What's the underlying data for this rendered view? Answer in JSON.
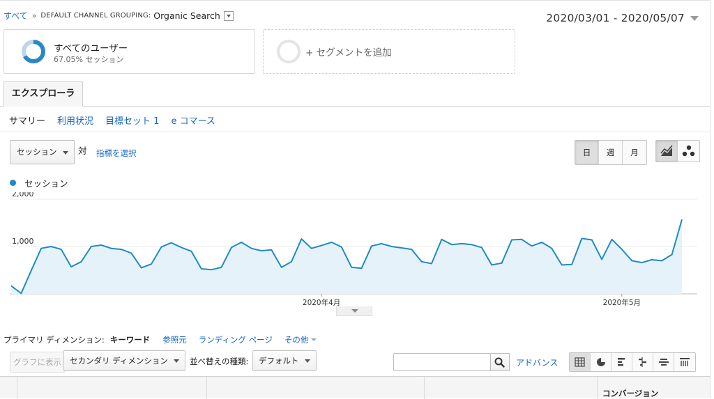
{
  "breadcrumb": {
    "root": "すべて",
    "separator": "»",
    "dimension": "DEFAULT CHANNEL GROUPING:",
    "value": "Organic Search"
  },
  "date_range": "2020/03/01 - 2020/05/07",
  "segments": {
    "all_users": {
      "title": "すべてのユーザー",
      "subtitle": "67.05% セッション",
      "share": 0.6705
    },
    "add_segment": {
      "label": "+ セグメントを追加"
    }
  },
  "explorer_tab": "エクスプローラ",
  "subtabs": [
    "サマリー",
    "利用状況",
    "目標セット 1",
    "e コマース"
  ],
  "metric": {
    "selected": "セッション",
    "vs": "対",
    "choose": "指標を選択"
  },
  "period_buttons": [
    "日",
    "週",
    "月"
  ],
  "chart_type_icons": [
    "line-chart-icon",
    "motion-chart-icon"
  ],
  "legend": {
    "series_name": "セッション",
    "color": "#1f8ac6"
  },
  "chart_data": {
    "type": "area",
    "title": "",
    "series": [
      {
        "name": "セッション",
        "values": [
          170,
          10,
          490,
          960,
          1000,
          940,
          570,
          680,
          1000,
          1030,
          960,
          940,
          860,
          550,
          630,
          990,
          1080,
          980,
          900,
          530,
          510,
          560,
          980,
          1090,
          960,
          910,
          930,
          560,
          680,
          1160,
          960,
          1020,
          1090,
          990,
          560,
          540,
          1010,
          1060,
          1000,
          970,
          940,
          680,
          640,
          1150,
          1040,
          1060,
          1040,
          980,
          610,
          650,
          1140,
          1150,
          1010,
          1090,
          960,
          610,
          620,
          1170,
          1140,
          730,
          1150,
          940,
          700,
          660,
          720,
          700,
          830,
          1570
        ]
      }
    ],
    "x_tick_labels": [
      {
        "label": "2020年4月",
        "index": 31
      },
      {
        "label": "2020年5月",
        "index": 61
      }
    ],
    "y_tick_labels": [
      "2,000",
      "1,000"
    ],
    "ylim": [
      0,
      2000
    ],
    "grid": true,
    "legend_position": "top-left"
  },
  "dimension_row": {
    "label": "プライマリ ディメンション:",
    "current": "キーワード",
    "links": [
      "参照元",
      "ランディング ページ"
    ],
    "more": "その他"
  },
  "toolbar": {
    "graph_button": "グラフに表示",
    "secondary_dimension": "セカンダリ ディメンション",
    "sort_label": "並べ替えの種類:",
    "sort_value": "デフォルト",
    "search_placeholder": "",
    "advanced": "アドバンス"
  },
  "view_icons": [
    "table-view-icon",
    "pie-view-icon",
    "performance-view-icon",
    "comparison-view-icon",
    "term-cloud-view-icon",
    "pivot-view-icon"
  ],
  "table": {
    "conversion_header": "コンバージョン"
  }
}
